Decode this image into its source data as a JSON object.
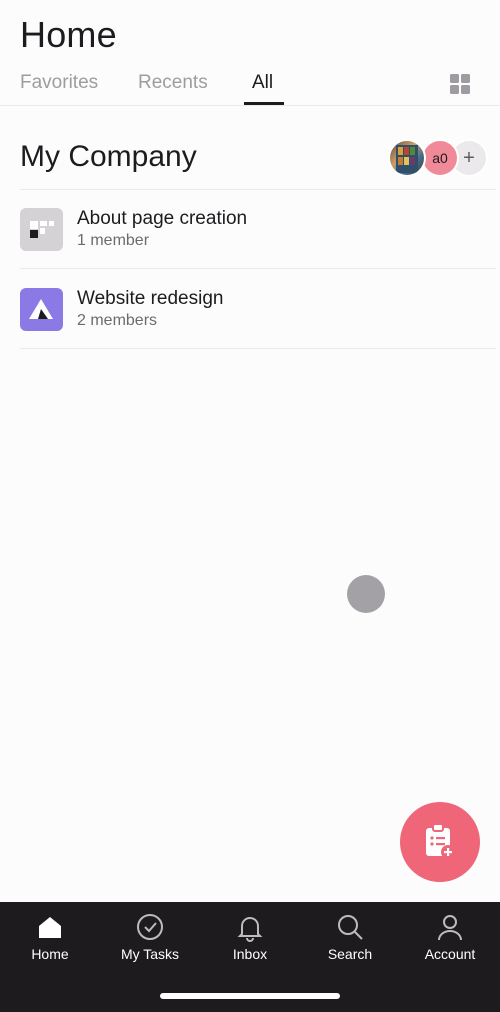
{
  "header": {
    "title": "Home"
  },
  "tabs": [
    {
      "label": "Favorites",
      "active": false
    },
    {
      "label": "Recents",
      "active": false
    },
    {
      "label": "All",
      "active": true
    }
  ],
  "layout_toggle_icon": "grid-icon",
  "workspace": {
    "name": "My Company",
    "members_avatars": [
      {
        "type": "photo",
        "label": ""
      },
      {
        "type": "initials",
        "label": "a0"
      },
      {
        "type": "add",
        "label": "+"
      }
    ]
  },
  "projects": [
    {
      "name": "About page creation",
      "members": "1 member",
      "icon": "board-icon",
      "icon_color": "#d4d2d5"
    },
    {
      "name": "Website redesign",
      "members": "2 members",
      "icon": "mountain-icon",
      "icon_color": "#8b79e6"
    }
  ],
  "fab": {
    "icon": "add-task-icon",
    "color": "#ef6678"
  },
  "bottom_nav": [
    {
      "label": "Home",
      "icon": "home-icon",
      "active": true
    },
    {
      "label": "My Tasks",
      "icon": "check-circle-icon",
      "active": false
    },
    {
      "label": "Inbox",
      "icon": "bell-icon",
      "active": false
    },
    {
      "label": "Search",
      "icon": "search-icon",
      "active": false
    },
    {
      "label": "Account",
      "icon": "person-icon",
      "active": false
    }
  ],
  "colors": {
    "accent": "#ef6678",
    "nav_bg": "#1d1b1e",
    "purple": "#8b79e6"
  }
}
